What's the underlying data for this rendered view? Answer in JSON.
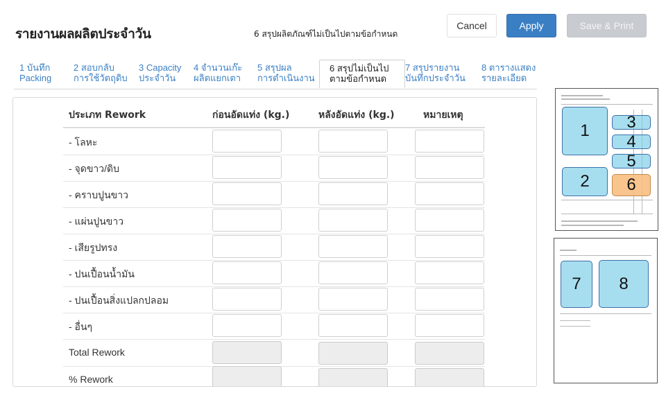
{
  "header": {
    "title": "รายงานผลผลิตประจำวัน",
    "subtitle": "6 สรุปผลิตภัณฑ์ไม่เป็นไปตามข้อกำหนด"
  },
  "buttons": {
    "cancel": "Cancel",
    "apply": "Apply",
    "save_print": "Save & Print"
  },
  "tabs": [
    {
      "line1": "1 บันทึก",
      "line2": "Packing"
    },
    {
      "line1": "2 สอบกลับ",
      "line2": "การใช้วัตถุดิบ"
    },
    {
      "line1": "3 Capacity",
      "line2": "ประจำวัน"
    },
    {
      "line1": "4 จำนวนเก๊ะ",
      "line2": "ผลิตแยกเตา"
    },
    {
      "line1": "5 สรุปผล",
      "line2": "การดำเนินงาน"
    },
    {
      "line1": "6 สรุปไม่เป็นไป",
      "line2": "ตามข้อกำหนด"
    },
    {
      "line1": "7 สรุปรายงาน",
      "line2": "บันทึกประจำวัน"
    },
    {
      "line1": "8 ตารางแสดง",
      "line2": "รายละเอียด"
    }
  ],
  "active_tab_index": 5,
  "table": {
    "headers": [
      "ประเภท Rework",
      "ก่อนอัดแท่ง (kg.)",
      "หลังอัดแท่ง (kg.)",
      "หมายเหตุ"
    ],
    "rows": [
      "- โลหะ",
      "- จุดขาว/ดิบ",
      "- คราบปูนขาว",
      "- แผ่นปูนขาว",
      "- เสียรูปทรง",
      "- ปนเปื้อนน้ำมัน",
      "- ปนเปื้อนสิ่งแปลกปลอม",
      "- อื่นๆ"
    ],
    "summary_rows": [
      "Total Rework",
      "% Rework"
    ]
  },
  "thumbnails": {
    "page1_sections": [
      "1",
      "2",
      "3",
      "4",
      "5",
      "6"
    ],
    "page2_sections": [
      "7",
      "8"
    ]
  },
  "colors": {
    "accent": "#3a7fc4",
    "section_highlight": "#78cde6",
    "active_section": "#fabe82"
  }
}
